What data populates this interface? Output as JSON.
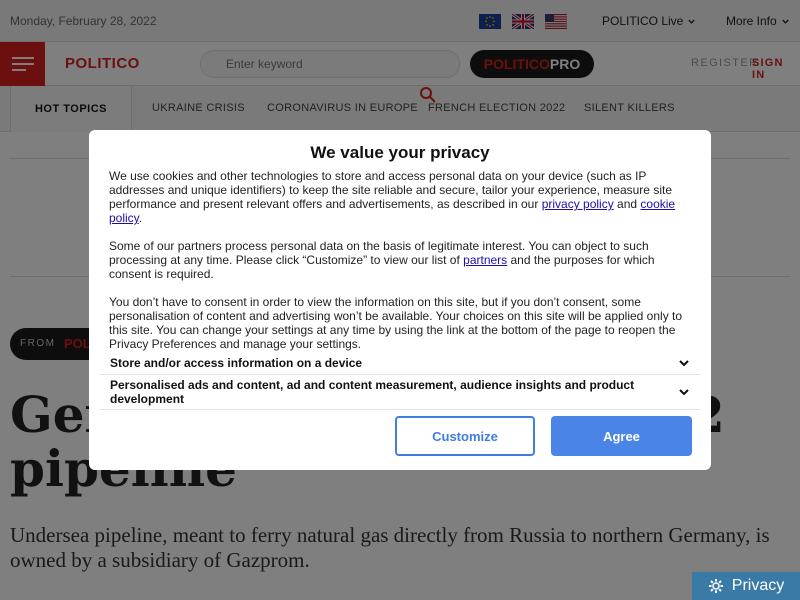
{
  "topbar": {
    "date": "Monday, February 28, 2022",
    "flags": [
      "eu-flag-icon",
      "uk-flag-icon",
      "us-flag-icon"
    ],
    "politico_live": "POLITICO Live",
    "more_info": "More Info"
  },
  "header": {
    "logo": "POLITICO",
    "search_placeholder": "Enter keyword",
    "pro_brand": "POLITICO",
    "pro_suffix": "PRO",
    "register": "REGISTER",
    "sign_in": "SIGN IN"
  },
  "nav": {
    "hot_topics": "HOT TOPICS",
    "items": [
      "UKRAINE CRISIS",
      "CORONAVIRUS IN EUROPE",
      "FRENCH ELECTION 2022",
      "SILENT KILLERS"
    ]
  },
  "article": {
    "from_label": "FROM",
    "from_brand": "POLI",
    "headline_line1": "Ger",
    "headline_line1_end": "2",
    "headline_line2": "pipeline",
    "dek": "Undersea pipeline, meant to ferry natural gas directly from Russia to northern Germany, is owned by a subsidiary of Gazprom."
  },
  "privacy_button": {
    "label": "Privacy",
    "icon": "gear-icon"
  },
  "consent": {
    "title": "We value your privacy",
    "p1_a": "We use cookies and other technologies to store and access personal data on your device (such as IP addresses and unique identifiers) to keep the site reliable and secure, tailor your experience, measure site performance and present relevant offers and advertisements, as described in our ",
    "p1_link1": "privacy policy",
    "p1_b": " and ",
    "p1_link2": "cookie policy",
    "p1_c": ".",
    "p2_a": "Some of our partners process personal data on the basis of legitimate interest. You can object to such processing at any time. Please click “Customize” to view our list of ",
    "p2_link": "partners",
    "p2_b": " and the purposes for which consent is required.",
    "p3": "You don’t have to consent in order to view the information on this site, but if you don’t consent, some personalisation of content and advertising won’t be available. Your choices on this site will be applied only to this site. You can change your settings at any time by using the link at the bottom of the page to reopen the Privacy Preferences and manage your settings.",
    "accordion": [
      "Store and/or access information on a device",
      "Personalised ads and content, ad and content measurement, audience insights and product development"
    ],
    "customize": "Customize",
    "agree": "Agree"
  },
  "colors": {
    "brand_red": "#d6201f",
    "button_blue": "#4a84e6",
    "privacy_blue": "#3a7aa6"
  }
}
